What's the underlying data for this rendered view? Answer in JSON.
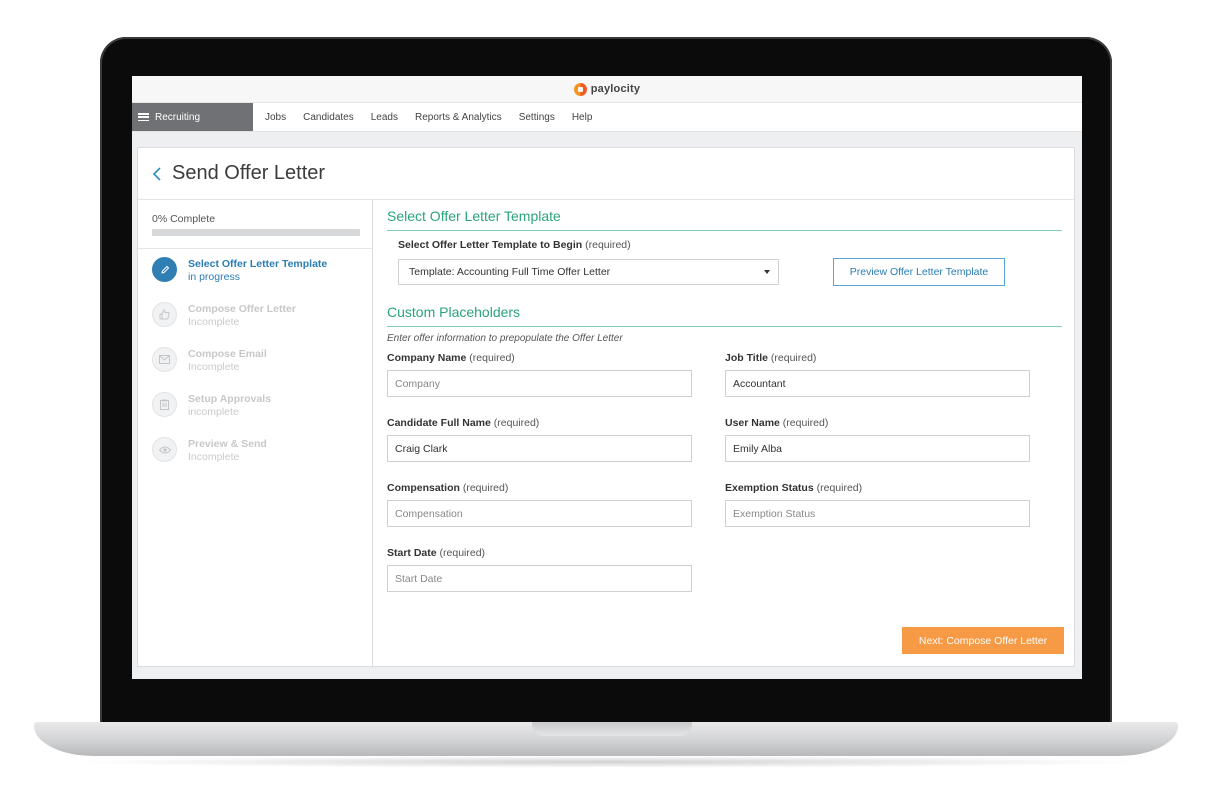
{
  "brand": {
    "name": "paylocity"
  },
  "nav": {
    "module_label": "Recruiting",
    "items": [
      "Jobs",
      "Candidates",
      "Leads",
      "Reports & Analytics",
      "Settings",
      "Help"
    ]
  },
  "page": {
    "title": "Send Offer Letter"
  },
  "progress": {
    "label": "0% Complete",
    "value": 0
  },
  "steps": [
    {
      "title": "Select Offer Letter Template",
      "status": "in progress",
      "icon": "pencil-icon",
      "active": true
    },
    {
      "title": "Compose Offer Letter",
      "status": "Incomplete",
      "icon": "thumbs-up-icon",
      "active": false
    },
    {
      "title": "Compose Email",
      "status": "Incomplete",
      "icon": "envelope-icon",
      "active": false
    },
    {
      "title": "Setup Approvals",
      "status": "incomplete",
      "icon": "clipboard-icon",
      "active": false
    },
    {
      "title": "Preview & Send",
      "status": "Incomplete",
      "icon": "eye-icon",
      "active": false
    }
  ],
  "template_section": {
    "title": "Select Offer Letter Template",
    "select_label": "Select Offer Letter Template to Begin",
    "select_required": "(required)",
    "selected_value": "Template: Accounting Full Time Offer Letter",
    "preview_button": "Preview Offer Letter Template"
  },
  "placeholders_section": {
    "title": "Custom Placeholders",
    "helper": "Enter offer information to prepopulate the Offer Letter",
    "fields": {
      "company_name": {
        "label": "Company Name",
        "required": "(required)",
        "value": "",
        "placeholder": "Company"
      },
      "job_title": {
        "label": "Job Title",
        "required": "(required)",
        "value": "Accountant",
        "placeholder": ""
      },
      "candidate_full_name": {
        "label": "Candidate Full Name",
        "required": "(required)",
        "value": "Craig Clark",
        "placeholder": ""
      },
      "user_name": {
        "label": "User Name",
        "required": "(required)",
        "value": "Emily Alba",
        "placeholder": ""
      },
      "compensation": {
        "label": "Compensation",
        "required": "(required)",
        "value": "",
        "placeholder": "Compensation"
      },
      "exemption_status": {
        "label": "Exemption Status",
        "required": "(required)",
        "value": "",
        "placeholder": "Exemption Status"
      },
      "start_date": {
        "label": "Start Date",
        "required": "(required)",
        "value": "",
        "placeholder": "Start Date"
      }
    }
  },
  "actions": {
    "next_button": "Next: Compose Offer Letter"
  },
  "colors": {
    "accent_green": "#2aa37d",
    "accent_blue": "#2b7db3",
    "cta_orange": "#f79a46"
  }
}
